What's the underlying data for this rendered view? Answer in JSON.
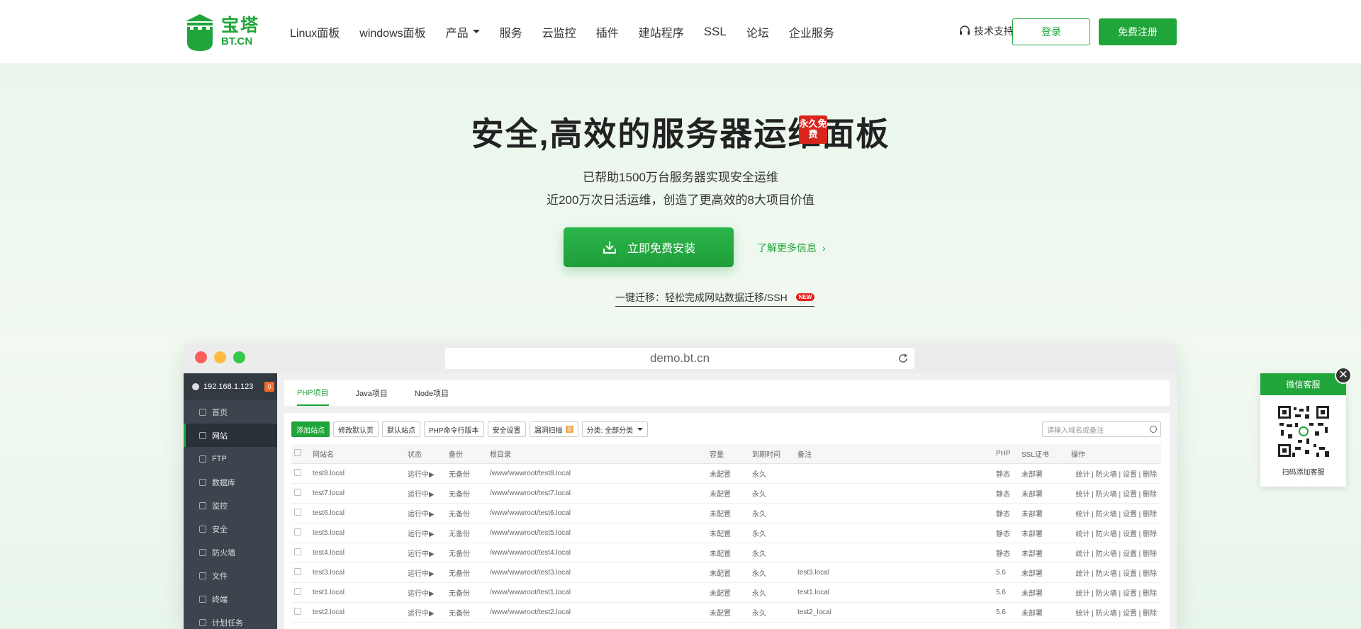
{
  "brand": {
    "cn": "宝塔",
    "en": "BT.CN",
    "color": "#20a53a"
  },
  "nav": {
    "items": [
      "Linux面板",
      "windows面板",
      "产品",
      "服务",
      "云监控",
      "插件",
      "建站程序",
      "SSL",
      "论坛",
      "企业服务"
    ],
    "support": "技术支持",
    "login": "登录",
    "register": "免费注册"
  },
  "hero": {
    "title": "安全,高效的服务器运维面板",
    "seal": "永久免费",
    "sub1": "已帮助1500万台服务器实现安全运维",
    "sub2": "近200万次日活运维，创造了更高效的8大项目价值",
    "download": "立即免费安装",
    "more": "了解更多信息",
    "ssh_link": "一键迁移：轻松完成网站数据迁移/SSH",
    "new_badge": "NEW"
  },
  "browser": {
    "url": "demo.bt.cn",
    "ip": "192.168.1.123",
    "ip_badge": "0",
    "sidebar": [
      {
        "label": "首页",
        "icon": "home-icon"
      },
      {
        "label": "网站",
        "icon": "globe-icon",
        "active": true
      },
      {
        "label": "FTP",
        "icon": "ftp-icon"
      },
      {
        "label": "数据库",
        "icon": "database-icon"
      },
      {
        "label": "监控",
        "icon": "monitor-icon"
      },
      {
        "label": "安全",
        "icon": "shield-icon"
      },
      {
        "label": "防火墙",
        "icon": "firewall-icon"
      },
      {
        "label": "文件",
        "icon": "folder-icon"
      },
      {
        "label": "终端",
        "icon": "terminal-icon"
      },
      {
        "label": "计划任务",
        "icon": "clock-icon"
      }
    ],
    "tabs": [
      "PHP项目",
      "Java项目",
      "Node项目"
    ],
    "toolbar": {
      "add": "添加站点",
      "default_page": "修改默认页",
      "default_site": "默认站点",
      "php_cli": "PHP命令行版本",
      "security": "安全设置",
      "scan": "漏洞扫描",
      "scan_count": "0",
      "category": "分类: 全部分类",
      "search_placeholder": "请输入域名或备注"
    },
    "columns": [
      "网站名",
      "状态",
      "备份",
      "根目录",
      "容量",
      "到期时间",
      "备注",
      "PHP",
      "SSL证书",
      "操作"
    ],
    "rows": [
      {
        "name": "test8.local",
        "status": "运行中▶",
        "backup": "无备份",
        "path": "/www/wwwroot/test8.local",
        "quota": "未配置",
        "expire": "永久",
        "remark": "",
        "php": "静态",
        "ssl": "未部署",
        "ops": "统计 | 防火墙 | 设置 | 删除"
      },
      {
        "name": "test7.local",
        "status": "运行中▶",
        "backup": "无备份",
        "path": "/www/wwwroot/test7.local",
        "quota": "未配置",
        "expire": "永久",
        "remark": "",
        "php": "静态",
        "ssl": "未部署",
        "ops": "统计 | 防火墙 | 设置 | 删除"
      },
      {
        "name": "test6.local",
        "status": "运行中▶",
        "backup": "无备份",
        "path": "/www/wwwroot/test6.local",
        "quota": "未配置",
        "expire": "永久",
        "remark": "",
        "php": "静态",
        "ssl": "未部署",
        "ops": "统计 | 防火墙 | 设置 | 删除"
      },
      {
        "name": "test5.local",
        "status": "运行中▶",
        "backup": "无备份",
        "path": "/www/wwwroot/test5.local",
        "quota": "未配置",
        "expire": "永久",
        "remark": "",
        "php": "静态",
        "ssl": "未部署",
        "ops": "统计 | 防火墙 | 设置 | 删除"
      },
      {
        "name": "test4.local",
        "status": "运行中▶",
        "backup": "无备份",
        "path": "/www/wwwroot/test4.local",
        "quota": "未配置",
        "expire": "永久",
        "remark": "",
        "php": "静态",
        "ssl": "未部署",
        "ops": "统计 | 防火墙 | 设置 | 删除"
      },
      {
        "name": "test3.local",
        "status": "运行中▶",
        "backup": "无备份",
        "path": "/www/wwwroot/test3.local",
        "quota": "未配置",
        "expire": "永久",
        "remark": "test3.local",
        "php": "5.6",
        "ssl": "未部署",
        "ops": "统计 | 防火墙 | 设置 | 删除"
      },
      {
        "name": "test1.local",
        "status": "运行中▶",
        "backup": "无备份",
        "path": "/www/wwwroot/test1.local",
        "quota": "未配置",
        "expire": "永久",
        "remark": "test1.local",
        "php": "5.6",
        "ssl": "未部署",
        "ops": "统计 | 防火墙 | 设置 | 删除"
      },
      {
        "name": "test2.local",
        "status": "运行中▶",
        "backup": "无备份",
        "path": "/www/wwwroot/test2.local",
        "quota": "未配置",
        "expire": "永久",
        "remark": "test2_local",
        "php": "5.6",
        "ssl": "未部署",
        "ops": "统计 | 防火墙 | 设置 | 删除"
      }
    ]
  },
  "qr": {
    "title": "微信客服",
    "caption": "扫码添加客服",
    "close": "✕"
  }
}
